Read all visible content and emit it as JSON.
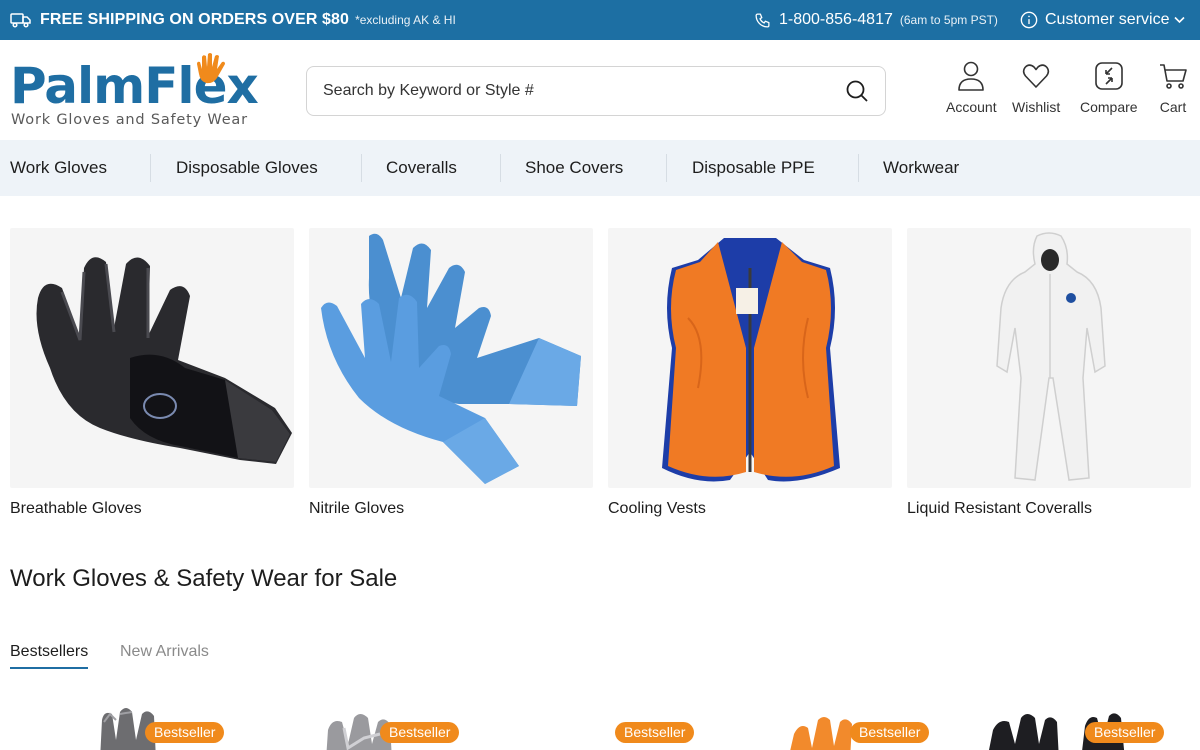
{
  "topbar": {
    "shipping_main": "FREE SHIPPING ON ORDERS OVER $80",
    "shipping_note": "*excluding AK & HI",
    "phone": "1-800-856-4817",
    "phone_hours": "(6am to 5pm PST)",
    "customer_service": "Customer service",
    "bg_color": "#1d6fa3"
  },
  "header": {
    "logo_word": "PalmFlex",
    "logo_tagline": "Work Gloves and Safety Wear",
    "search_placeholder": "Search by Keyword or Style #",
    "icons": [
      {
        "label": "Account",
        "icon": "user-icon"
      },
      {
        "label": "Wishlist",
        "icon": "heart-icon"
      },
      {
        "label": "Compare",
        "icon": "compare-icon"
      },
      {
        "label": "Cart",
        "icon": "cart-icon"
      }
    ]
  },
  "nav": {
    "items": [
      "Work Gloves",
      "Disposable Gloves",
      "Coveralls",
      "Shoe Covers",
      "Disposable PPE",
      "Workwear"
    ]
  },
  "categories": [
    {
      "label": "Breathable Gloves",
      "image": "breathable-glove-image"
    },
    {
      "label": "Nitrile Gloves",
      "image": "nitrile-gloves-image"
    },
    {
      "label": "Cooling Vests",
      "image": "cooling-vest-image"
    },
    {
      "label": "Liquid Resistant Coveralls",
      "image": "coverall-image"
    }
  ],
  "section": {
    "title": "Work Gloves & Safety Wear for Sale",
    "tabs": [
      {
        "label": "Bestsellers",
        "active": true
      },
      {
        "label": "New Arrivals",
        "active": false
      }
    ]
  },
  "products": [
    {
      "badge": "Bestseller"
    },
    {
      "badge": "Bestseller"
    },
    {
      "badge": "Bestseller"
    },
    {
      "badge": "Bestseller"
    },
    {
      "badge": "Bestseller"
    }
  ],
  "colors": {
    "brand_blue": "#1f6ea3",
    "logo_orange": "#f08a1c",
    "badge_orange": "#f08a1c",
    "nav_bg": "#eef3f8"
  }
}
